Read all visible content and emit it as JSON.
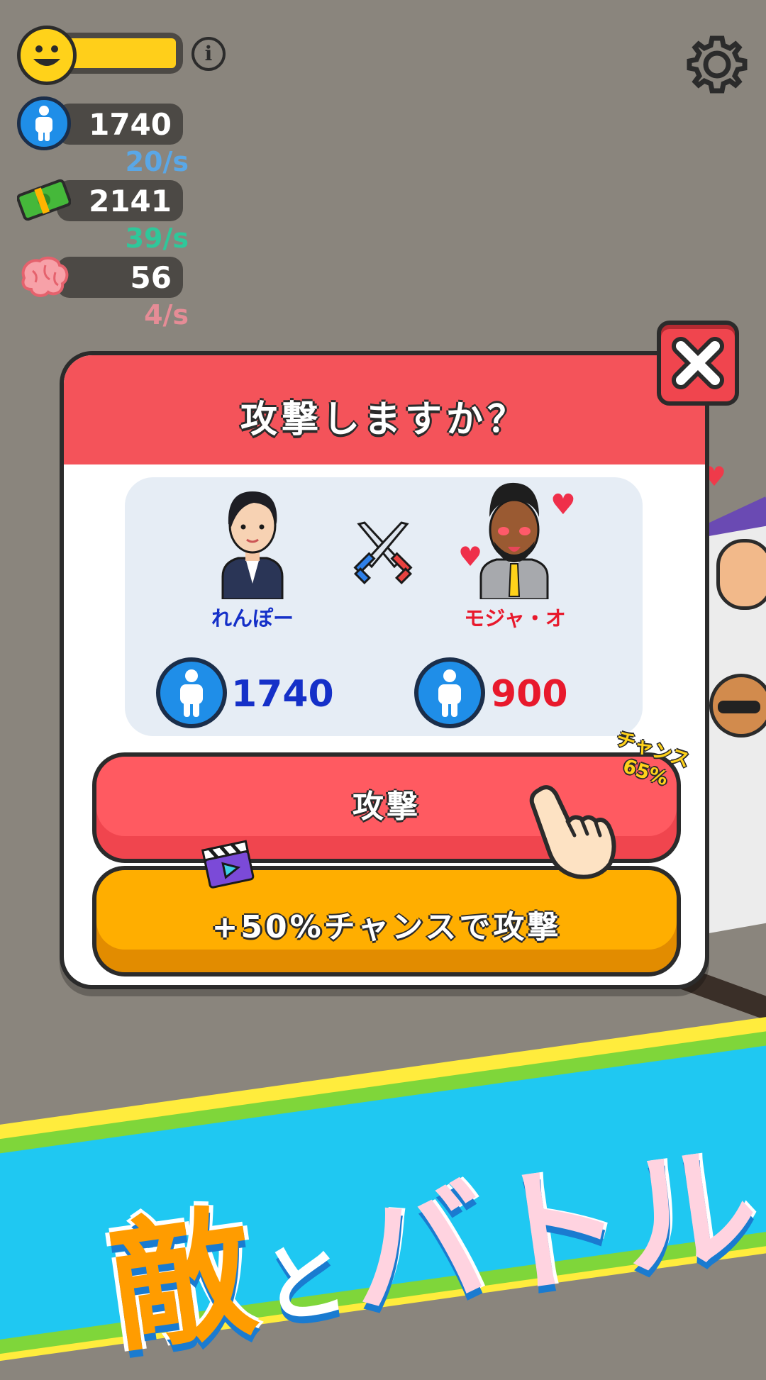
{
  "hud": {
    "population": {
      "value": "1740",
      "rate": "20/s"
    },
    "money": {
      "value": "2141",
      "rate": "39/s"
    },
    "brain": {
      "value": "56",
      "rate": "4/s"
    },
    "happiness_level": 1.0
  },
  "dialog": {
    "title": "攻撃しますか？",
    "player": {
      "name": "れんぽー",
      "count": "1740"
    },
    "enemy": {
      "name": "モジャ・オ",
      "count": "900"
    },
    "attack_label": "攻撃",
    "video_attack_label": "+50%チャンスで攻撃",
    "chance_label": "チャンス",
    "chance_value": "65%"
  },
  "banner": {
    "part1": "敵",
    "part2": "と",
    "part3": "バトル！"
  },
  "colors": {
    "accent_red": "#f4535a",
    "gold": "#ffae00",
    "player_blue": "#1530c8",
    "enemy_red": "#e8192c",
    "banner_blue": "#1fc8f2"
  }
}
